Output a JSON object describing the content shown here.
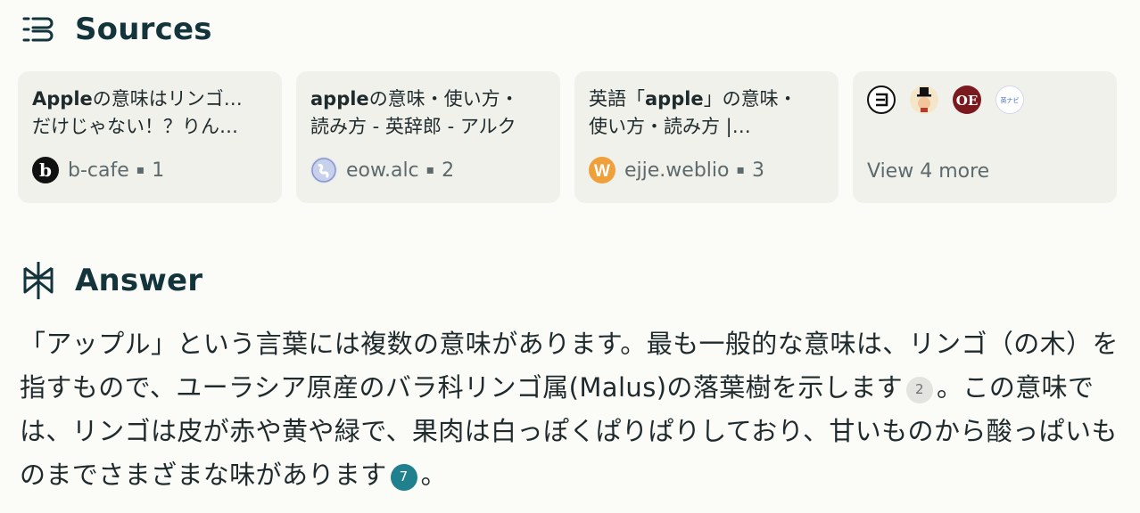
{
  "sources_section": {
    "title": "Sources",
    "icon": "sources-list-icon",
    "cards": [
      {
        "title_bold": "Apple",
        "title_rest": "の意味はリンゴ…",
        "title_line2": "だけじゃない！？りん…",
        "domain": "b-cafe",
        "index": "1",
        "favicon": "b-cafe-logo-icon"
      },
      {
        "title_bold": "apple",
        "title_rest": "の意味・使い方・",
        "title_line2": "読み方 - 英辞郎 - アルク",
        "domain": "eow.alc",
        "index": "2",
        "favicon": "globe-icon"
      },
      {
        "title_pre": "英語「",
        "title_bold": "apple",
        "title_rest": "」の意味・",
        "title_line2": "使い方・読み方 |…",
        "domain": "ejje.weblio",
        "index": "3",
        "favicon": "weblio-logo-icon"
      }
    ],
    "more": {
      "label": "View 4 more",
      "icons": [
        "kotobank-icon",
        "tophat-character-icon",
        "oed-icon",
        "eigo-navi-icon"
      ]
    }
  },
  "answer_section": {
    "title": "Answer",
    "icon": "perplexity-logo-icon",
    "text_part1": "「アップル」という言葉には複数の意味があります。最も一般的な意味は、リンゴ（の木）を指すもので、ユーラシア原産のバラ科リンゴ属(Malus)の落葉樹を示します",
    "cite1": "2",
    "text_part2": "。この意味では、リンゴは皮が赤や黄や緑で、果肉は白っぽくぱりぱりしており、甘いものから酸っぱいものまでさまざまな味があります",
    "cite2": "7",
    "text_part3": "。"
  },
  "colors": {
    "background": "#fbfbf8",
    "card": "#f1f1ec",
    "heading": "#13343b",
    "accent_teal": "#20808d",
    "muted": "#5c6a6d"
  }
}
